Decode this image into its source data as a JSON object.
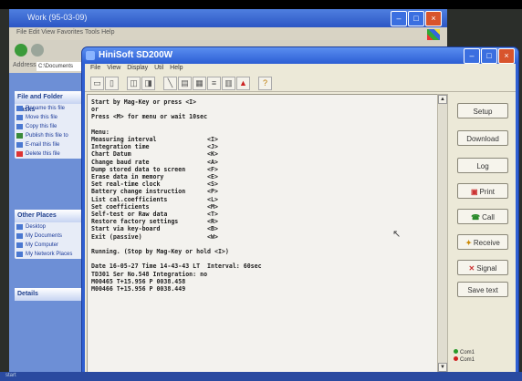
{
  "explorer": {
    "title": "Work (95-03-09)",
    "menu": "File  Edit  View  Favorites  Tools  Help",
    "address_label": "Address",
    "address_value": "C:\\Documents",
    "file_folder_tasks": {
      "heading": "File and Folder Tasks",
      "items": [
        "Rename this file",
        "Move this file",
        "Copy this file",
        "Publish this file to",
        "E-mail this file",
        "Delete this file"
      ]
    },
    "other_places": {
      "heading": "Other Places",
      "items": [
        "Desktop",
        "My Documents",
        "My Computer",
        "My Network Places"
      ]
    },
    "details": {
      "heading": "Details"
    }
  },
  "app": {
    "title": "HiniSoft SD200W",
    "menu": "File  View  Display  Util  Help",
    "terminal_lines": [
      "Start by Mag-Key or press <I>",
      "or",
      "Press <M> for menu or wait 10sec",
      "",
      "Menu:",
      "Measuring interval              <I>",
      "Integration time                <J>",
      "Chart Datum                     <K>",
      "Change baud rate                <A>",
      "Dump stored data to screen      <F>",
      "Erase data in memory            <E>",
      "Set real-time clock             <S>",
      "Battery change instruction      <P>",
      "List cal.coefficients           <L>",
      "Set coefficients                <M>",
      "Self-test or Raw data           <T>",
      "Restore factory settings        <R>",
      "Start via key-board             <B>",
      "Exit (passive)                  <W>",
      "",
      "Running. (Stop by Mag-Key or hold <I>)",
      "",
      "Date 16-05-27 Time 14-43-43 LT  Interval: 60sec",
      "TD301 Ser No.548 Integration: no",
      "M00465 T+15.956 P 0038.458",
      "M00466 T+15.956 P 0038.449"
    ],
    "buttons": {
      "setup": "Setup",
      "download": "Download",
      "log": "Log",
      "print": "Print",
      "call": "Call",
      "receive": "Receive",
      "signal": "Signal",
      "save_text": "Save text"
    },
    "status": {
      "com1_a": "Com1",
      "com1_b": "Com1",
      "com1_a_color": "#2a9a2a",
      "com1_b_color": "#d02020"
    }
  },
  "taskbar": {
    "text": "start"
  }
}
